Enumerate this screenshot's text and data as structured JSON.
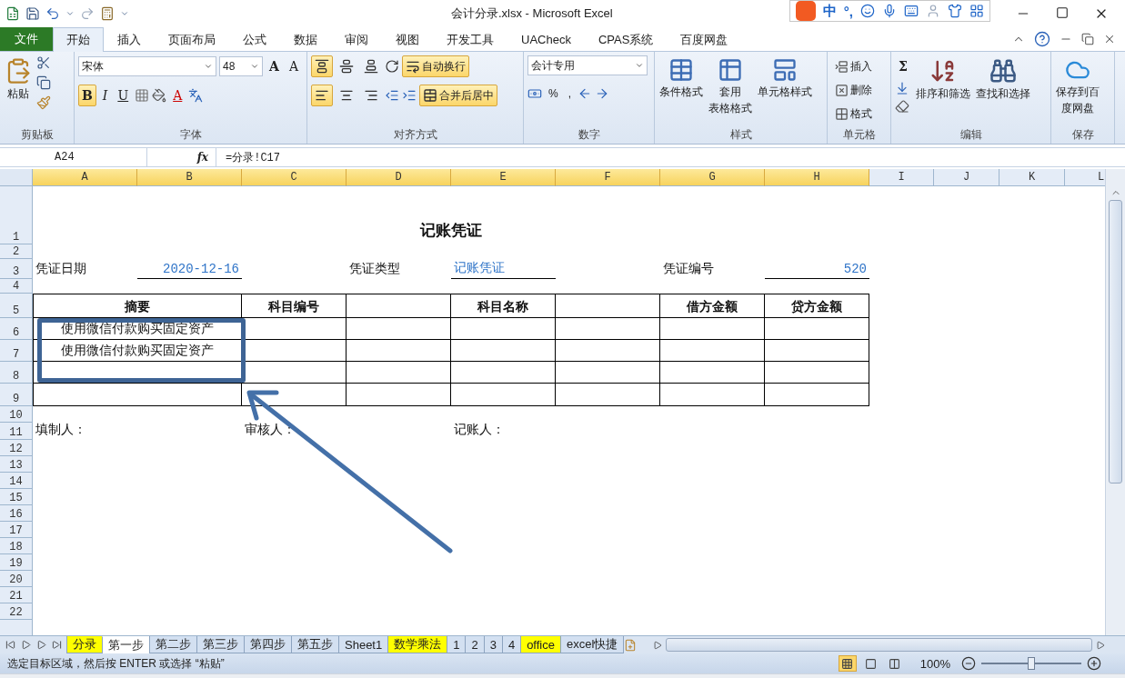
{
  "window": {
    "title": "会计分录.xlsx  -  Microsoft Excel"
  },
  "ime_bar": {
    "language": "中",
    "punctuation": "°,"
  },
  "ribbon_tabs": [
    {
      "label": "文件",
      "kind": "file",
      "selected": false
    },
    {
      "label": "开始",
      "kind": "tab",
      "selected": true
    },
    {
      "label": "插入",
      "kind": "tab",
      "selected": false
    },
    {
      "label": "页面布局",
      "kind": "tab",
      "selected": false
    },
    {
      "label": "公式",
      "kind": "tab",
      "selected": false
    },
    {
      "label": "数据",
      "kind": "tab",
      "selected": false
    },
    {
      "label": "审阅",
      "kind": "tab",
      "selected": false
    },
    {
      "label": "视图",
      "kind": "tab",
      "selected": false
    },
    {
      "label": "开发工具",
      "kind": "tab",
      "selected": false
    },
    {
      "label": "UACheck",
      "kind": "tab",
      "selected": false
    },
    {
      "label": "CPAS系统",
      "kind": "tab",
      "selected": false
    },
    {
      "label": "百度网盘",
      "kind": "tab",
      "selected": false
    }
  ],
  "clipboard": {
    "paste": "粘贴",
    "group": "剪贴板"
  },
  "font": {
    "name": "宋体",
    "size": "48",
    "grow": "A",
    "shrink": "A",
    "font_color": "A",
    "group": "字体",
    "styles": [
      {
        "label": "B",
        "kind": "bold",
        "on": true
      },
      {
        "label": "I",
        "kind": "italic",
        "on": false
      },
      {
        "label": "U",
        "kind": "underline",
        "on": false
      }
    ]
  },
  "alignment": {
    "group": "对齐方式",
    "vertical": [
      {
        "selected": true
      },
      {
        "selected": false
      },
      {
        "selected": false
      }
    ],
    "horizontal": [
      {
        "selected": true
      },
      {
        "selected": false
      },
      {
        "selected": false
      }
    ],
    "wrap": {
      "label": "自动换行",
      "on": true
    },
    "merge": {
      "label": "合并后居中",
      "on": true
    }
  },
  "number": {
    "format": "会计专用",
    "percent": "%",
    "comma": ",",
    "group": "数字"
  },
  "styles": {
    "group": "样式",
    "buttons": [
      {
        "lines": [
          "条件格式"
        ]
      },
      {
        "lines": [
          "套用",
          "表格格式"
        ]
      },
      {
        "lines": [
          "单元格样式"
        ]
      }
    ]
  },
  "cells": {
    "group": "单元格",
    "items": [
      "插入",
      "删除",
      "格式"
    ]
  },
  "editing": {
    "group": "编辑",
    "sum": "Σ",
    "sort": "排序和筛选",
    "find": "查找和选择"
  },
  "save": {
    "group": "保存",
    "lines": [
      "保存到百",
      "度网盘"
    ]
  },
  "formula_bar": {
    "name_box": "A24",
    "function_label": "fx",
    "formula": "=分录!C17"
  },
  "columns": [
    {
      "label": "A",
      "selected": true
    },
    {
      "label": "B",
      "selected": true
    },
    {
      "label": "C",
      "selected": true
    },
    {
      "label": "D",
      "selected": true
    },
    {
      "label": "E",
      "selected": true
    },
    {
      "label": "F",
      "selected": true
    },
    {
      "label": "G",
      "selected": true
    },
    {
      "label": "H",
      "selected": true
    },
    {
      "label": "I",
      "selected": false
    },
    {
      "label": "J",
      "selected": false
    },
    {
      "label": "K",
      "selected": false
    },
    {
      "label": "L",
      "selected": false
    }
  ],
  "rows": [
    {
      "label": "1",
      "cells": [
        {
          "kind": "title",
          "text": "记账凭证"
        }
      ]
    },
    {
      "label": "2",
      "cells": []
    },
    {
      "label": "3",
      "cells": [
        {
          "kind": "label",
          "text": "凭证日期"
        },
        {
          "kind": "date",
          "text": "2020-12-16"
        },
        {
          "kind": "empty"
        },
        {
          "kind": "label",
          "text": "凭证类型"
        },
        {
          "kind": "text",
          "text": "记账凭证"
        },
        {
          "kind": "empty"
        },
        {
          "kind": "label",
          "text": "凭证编号"
        },
        {
          "kind": "number",
          "text": "520"
        }
      ]
    },
    {
      "label": "4",
      "cells": []
    },
    {
      "label": "5",
      "cells": [
        {
          "kind": "header_wide",
          "text": "摘要"
        },
        {
          "kind": "header",
          "text": "科目编号"
        },
        {
          "kind": "header"
        },
        {
          "kind": "header",
          "text": "科目名称"
        },
        {
          "kind": "header"
        },
        {
          "kind": "header",
          "text": "借方金额"
        },
        {
          "kind": "header",
          "text": "贷方金额"
        }
      ]
    },
    {
      "label": "6",
      "cells": [
        {
          "kind": "body_wide",
          "text": "使用微信付款购买固定资产"
        },
        {
          "kind": "body"
        },
        {
          "kind": "body"
        },
        {
          "kind": "body"
        },
        {
          "kind": "body"
        },
        {
          "kind": "body"
        },
        {
          "kind": "body"
        }
      ]
    },
    {
      "label": "7",
      "cells": [
        {
          "kind": "body_wide",
          "text": "使用微信付款购买固定资产"
        },
        {
          "kind": "body"
        },
        {
          "kind": "body"
        },
        {
          "kind": "body"
        },
        {
          "kind": "body"
        },
        {
          "kind": "body"
        },
        {
          "kind": "body"
        }
      ]
    },
    {
      "label": "8",
      "cells": [
        {
          "kind": "body_wide"
        },
        {
          "kind": "body"
        },
        {
          "kind": "body"
        },
        {
          "kind": "body"
        },
        {
          "kind": "body"
        },
        {
          "kind": "body"
        },
        {
          "kind": "body"
        }
      ]
    },
    {
      "label": "9",
      "cells": [
        {
          "kind": "body_wide"
        },
        {
          "kind": "body"
        },
        {
          "kind": "body"
        },
        {
          "kind": "body"
        },
        {
          "kind": "body"
        },
        {
          "kind": "body"
        },
        {
          "kind": "body"
        }
      ]
    },
    {
      "label": "10",
      "cells": []
    },
    {
      "label": "11",
      "cells": [
        {
          "kind": "label",
          "text": "填制人："
        },
        {
          "kind": "empty"
        },
        {
          "kind": "label",
          "text": "审核人："
        },
        {
          "kind": "empty"
        },
        {
          "kind": "label",
          "text": "记账人："
        }
      ]
    },
    {
      "label": "12",
      "cells": []
    },
    {
      "label": "13",
      "cells": []
    },
    {
      "label": "14",
      "cells": []
    },
    {
      "label": "15",
      "cells": []
    },
    {
      "label": "16",
      "cells": []
    },
    {
      "label": "17",
      "cells": []
    },
    {
      "label": "18",
      "cells": []
    },
    {
      "label": "19",
      "cells": []
    },
    {
      "label": "20",
      "cells": []
    },
    {
      "label": "21",
      "cells": []
    },
    {
      "label": "22",
      "cells": []
    }
  ],
  "sheet_tabs": [
    {
      "label": "分录",
      "selected": false,
      "color": "#ffff00"
    },
    {
      "label": "第一步",
      "selected": true,
      "color": "#ffffff"
    },
    {
      "label": "第二步",
      "selected": false,
      "color": "#d3e0f1"
    },
    {
      "label": "第三步",
      "selected": false,
      "color": "#d3e0f1"
    },
    {
      "label": "第四步",
      "selected": false,
      "color": "#d3e0f1"
    },
    {
      "label": "第五步",
      "selected": false,
      "color": "#d3e0f1"
    },
    {
      "label": "Sheet1",
      "selected": false,
      "color": "#d3e0f1"
    },
    {
      "label": "数学乘法",
      "selected": false,
      "color": "#ffff00"
    },
    {
      "label": "1",
      "selected": false,
      "color": "#d3e0f1"
    },
    {
      "label": "2",
      "selected": false,
      "color": "#d3e0f1"
    },
    {
      "label": "3",
      "selected": false,
      "color": "#d3e0f1"
    },
    {
      "label": "4",
      "selected": false,
      "color": "#d3e0f1"
    },
    {
      "label": "office",
      "selected": false,
      "color": "#ffff00"
    },
    {
      "label": "excel快捷",
      "selected": false,
      "color": "#d3e0f1"
    }
  ],
  "status_bar": {
    "message": "选定目标区域，然后按 ENTER 或选择 “粘贴”",
    "views": [
      {
        "selected": true
      },
      {
        "selected": false
      },
      {
        "selected": false
      }
    ],
    "zoom": "100%",
    "zoom_slider": {
      "level": 0.5
    }
  }
}
